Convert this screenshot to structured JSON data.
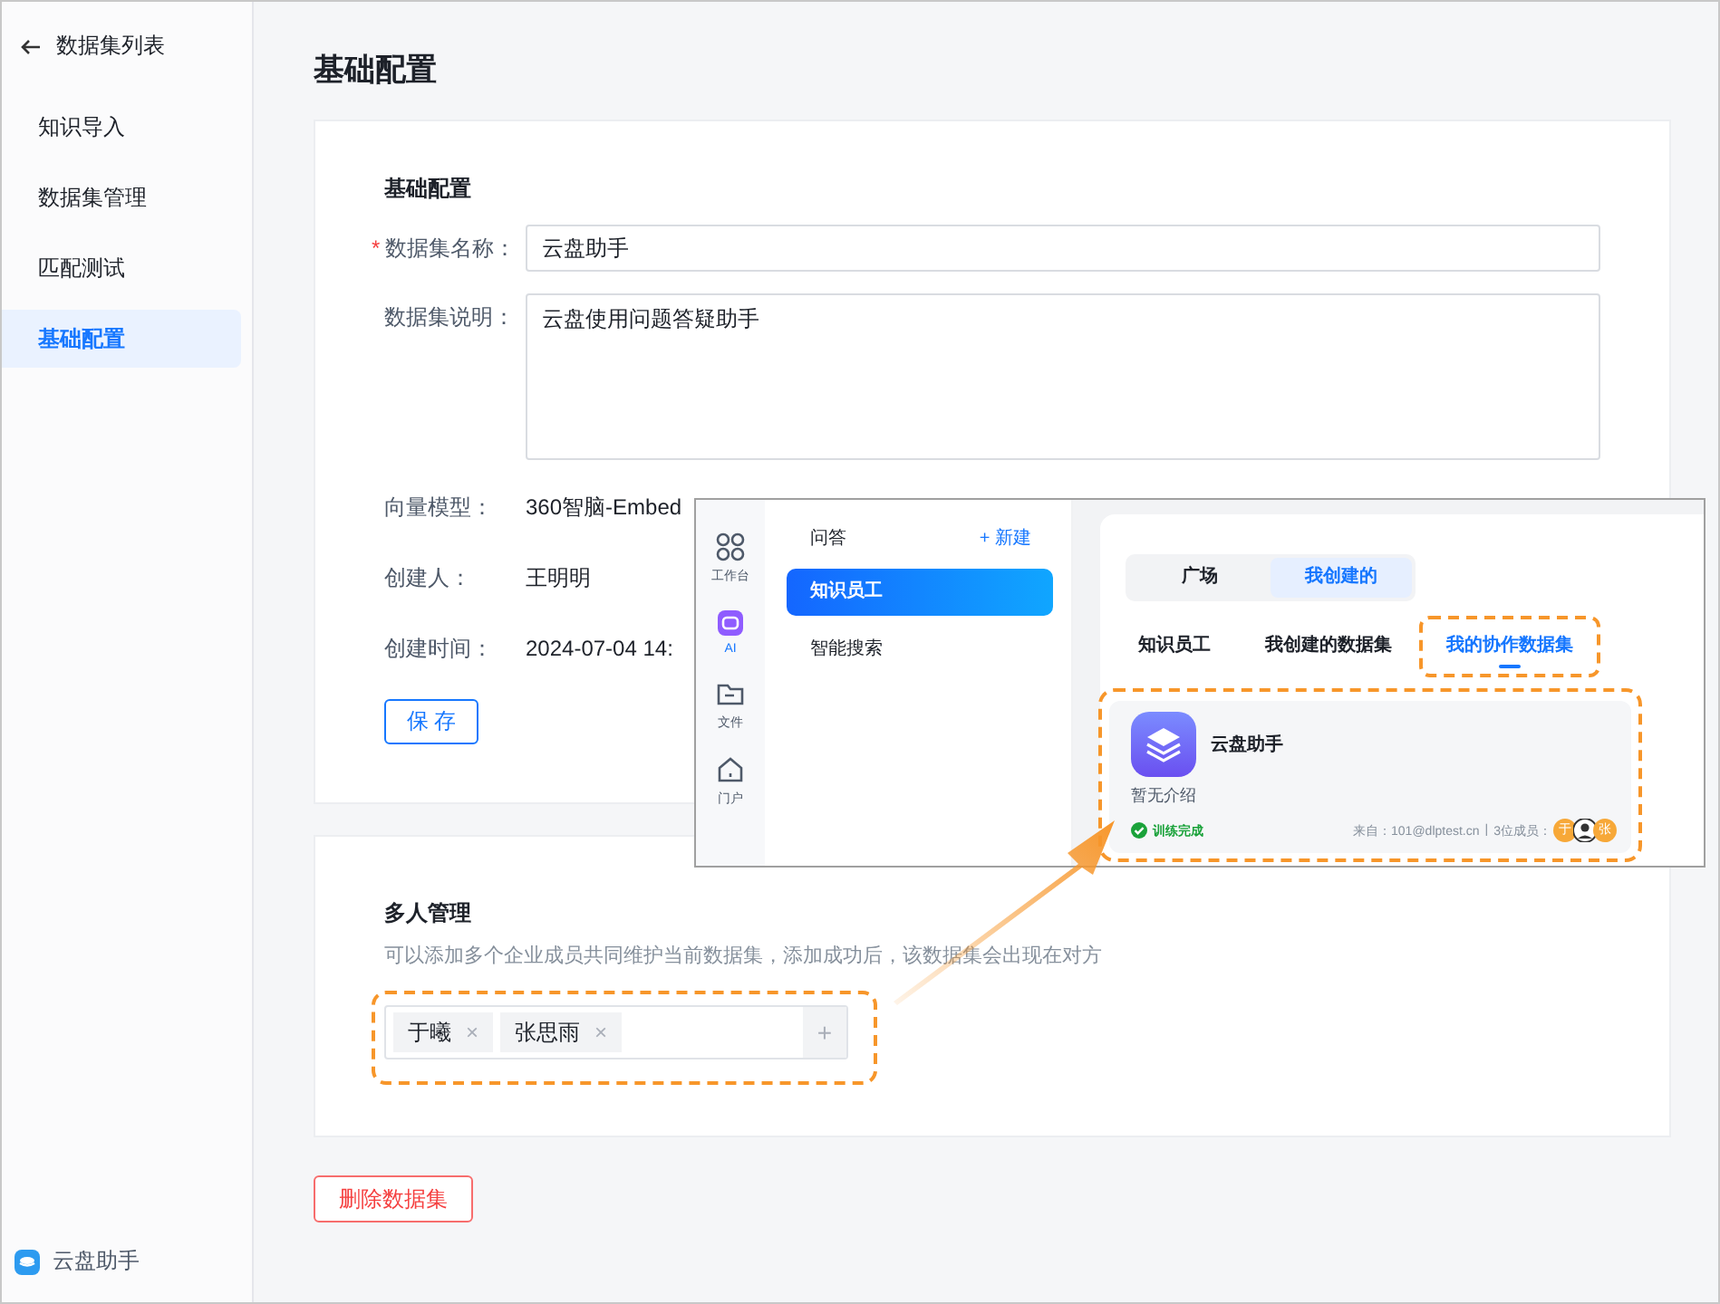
{
  "sidebar": {
    "back_link": "数据集列表",
    "items": [
      {
        "label": "知识导入",
        "selected": false
      },
      {
        "label": "数据集管理",
        "selected": false
      },
      {
        "label": "匹配测试",
        "selected": false
      },
      {
        "label": "基础配置",
        "selected": true
      }
    ],
    "footer": "云盘助手"
  },
  "page_title": "基础配置",
  "basic_config": {
    "title": "基础配置",
    "fields": [
      {
        "kind": "input",
        "required_mark": "*",
        "label": "数据集名称：",
        "value": "云盘助手"
      },
      {
        "kind": "textarea",
        "label": "数据集说明：",
        "value": "云盘使用问题答疑助手"
      },
      {
        "kind": "text",
        "label": "向量模型：",
        "value": "360智脑-Embed"
      },
      {
        "kind": "text",
        "label": "创建人：",
        "value": "王明明"
      },
      {
        "kind": "text",
        "label": "创建时间：",
        "value": "2024-07-04 14:"
      }
    ],
    "save_button": "保 存"
  },
  "members": {
    "title": "多人管理",
    "description": "可以添加多个企业成员共同维护当前数据集，添加成功后，该数据集会出现在对方",
    "highlighted": true,
    "tags": [
      {
        "name": "于曦",
        "remove": "×"
      },
      {
        "name": "张思雨",
        "remove": "×"
      }
    ],
    "add_button": "+"
  },
  "delete_button": "删除数据集",
  "overlay": {
    "rail": [
      {
        "kind": "grid",
        "label": "工作台",
        "selected": false
      },
      {
        "kind": "ai",
        "label": "AI",
        "selected": true
      },
      {
        "kind": "folder",
        "label": "文件",
        "selected": false
      },
      {
        "kind": "home",
        "label": "门户",
        "selected": false
      }
    ],
    "nav": {
      "header": "问答",
      "new_button": "+ 新建",
      "items": [
        {
          "label": "知识员工",
          "selected": true
        },
        {
          "label": "智能搜索",
          "selected": false
        }
      ]
    },
    "segments": [
      {
        "label": "广场",
        "selected": false
      },
      {
        "label": "我创建的",
        "selected": true
      }
    ],
    "tabs": [
      {
        "label": "知识员工",
        "selected": false,
        "highlighted": false
      },
      {
        "label": "我创建的数据集",
        "selected": false,
        "highlighted": false
      },
      {
        "label": "我的协作数据集",
        "selected": true,
        "highlighted": true
      }
    ],
    "card": {
      "title": "云盘助手",
      "description": "暂无介绍",
      "status": "训练完成",
      "source": "来自：101@dlptest.cn",
      "separator": "|",
      "members_label": "3位成员：",
      "highlighted": true,
      "avatars": [
        {
          "kind": "letter",
          "text": "于"
        },
        {
          "kind": "figure"
        },
        {
          "kind": "letter",
          "text": "张"
        }
      ]
    }
  }
}
